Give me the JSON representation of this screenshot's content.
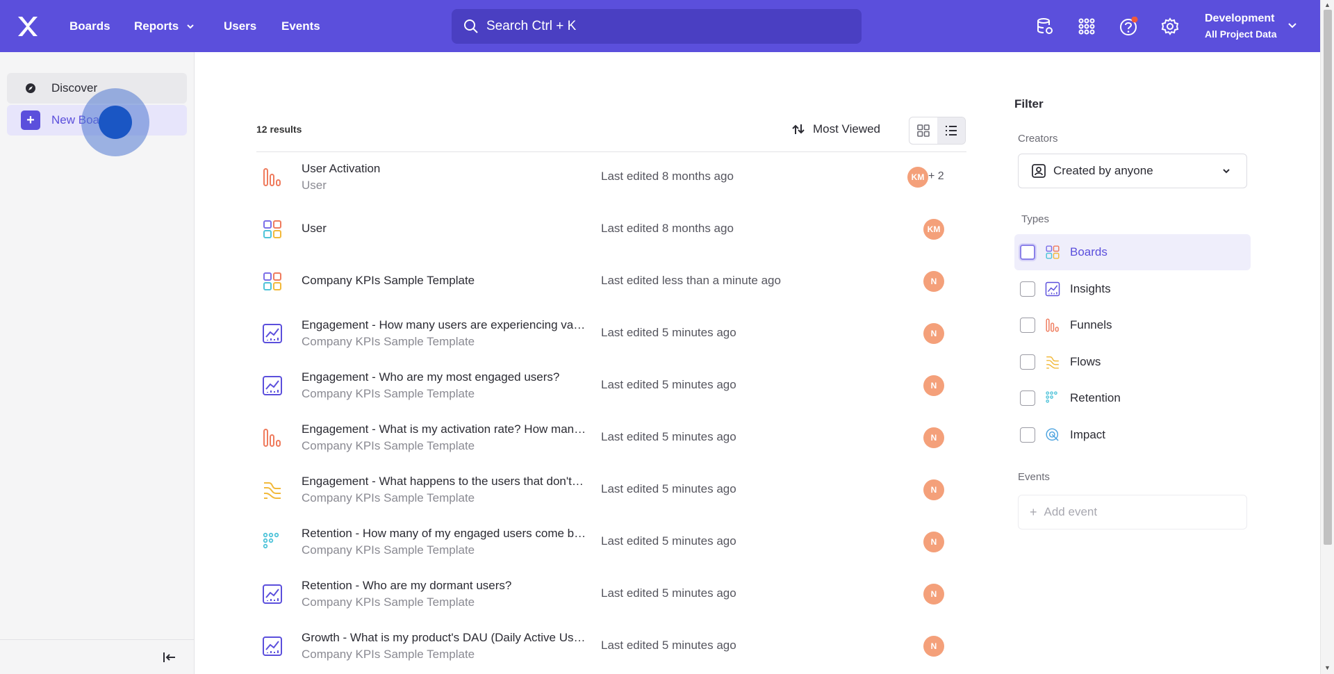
{
  "nav": {
    "items": [
      "Boards",
      "Reports",
      "Users",
      "Events"
    ],
    "search_placeholder": "Search  Ctrl + K",
    "project_name": "Development",
    "project_data": "All Project Data",
    "brand_color": "#5b4fdc"
  },
  "sidebar": {
    "discover_label": "Discover",
    "new_board_label": "New Board"
  },
  "list": {
    "results_count": "12 results",
    "sort_label": "Most Viewed",
    "rows": [
      {
        "icon": "funnels-icon",
        "title": "User Activation",
        "subtitle": "User",
        "edited": "Last edited 8 months ago",
        "avatar": "KM",
        "more": "+ 2"
      },
      {
        "icon": "boards-icon",
        "title": "User",
        "subtitle": "",
        "edited": "Last edited 8 months ago",
        "avatar": "KM",
        "more": ""
      },
      {
        "icon": "boards-icon",
        "title": "Company KPIs Sample Template",
        "subtitle": "",
        "edited": "Last edited less than a minute ago",
        "avatar": "N",
        "more": ""
      },
      {
        "icon": "insights-icon",
        "title": "Engagement - How many users are experiencing value?",
        "subtitle": "Company KPIs Sample Template",
        "edited": "Last edited 5 minutes ago",
        "avatar": "N",
        "more": ""
      },
      {
        "icon": "insights-icon",
        "title": "Engagement - Who are my most engaged users?",
        "subtitle": "Company KPIs Sample Template",
        "edited": "Last edited 5 minutes ago",
        "avatar": "N",
        "more": ""
      },
      {
        "icon": "funnels-icon",
        "title": "Engagement - What is my activation rate? How many users?",
        "subtitle": "Company KPIs Sample Template",
        "edited": "Last edited 5 minutes ago",
        "avatar": "N",
        "more": ""
      },
      {
        "icon": "flows-icon",
        "title": "Engagement - What happens to the users that don't activate?",
        "subtitle": "Company KPIs Sample Template",
        "edited": "Last edited 5 minutes ago",
        "avatar": "N",
        "more": ""
      },
      {
        "icon": "retention-icon",
        "title": "Retention - How many of my engaged users come back?",
        "subtitle": "Company KPIs Sample Template",
        "edited": "Last edited 5 minutes ago",
        "avatar": "N",
        "more": ""
      },
      {
        "icon": "insights-icon",
        "title": "Retention - Who are my dormant users?",
        "subtitle": "Company KPIs Sample Template",
        "edited": "Last edited 5 minutes ago",
        "avatar": "N",
        "more": ""
      },
      {
        "icon": "insights-icon",
        "title": "Growth - What is my product's DAU (Daily Active Users)?",
        "subtitle": "Company KPIs Sample Template",
        "edited": "Last edited 5 minutes ago",
        "avatar": "N",
        "more": ""
      }
    ]
  },
  "filter": {
    "title": "Filter",
    "creators_label": "Creators",
    "creators_value": "Created by anyone",
    "types_label": "Types",
    "types": [
      {
        "label": "Boards",
        "icon": "boards-icon"
      },
      {
        "label": "Insights",
        "icon": "insights-icon"
      },
      {
        "label": "Funnels",
        "icon": "funnels-icon"
      },
      {
        "label": "Flows",
        "icon": "flows-icon"
      },
      {
        "label": "Retention",
        "icon": "retention-icon"
      },
      {
        "label": "Impact",
        "icon": "impact-icon"
      }
    ],
    "events_label": "Events",
    "add_event_label": "Add event"
  }
}
